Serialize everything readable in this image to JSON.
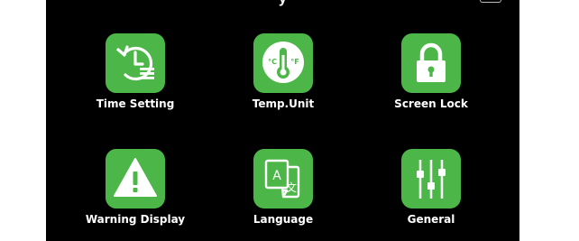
{
  "header": {
    "title_fragment": "y"
  },
  "colors": {
    "tile_green": "#4cb748",
    "background": "#000000",
    "text": "#ffffff"
  },
  "menu": {
    "items": [
      {
        "label": "Time Setting",
        "icon": "clock-history-icon"
      },
      {
        "label": "Temp.Unit",
        "icon": "thermometer-icon",
        "icon_text_c": "°C",
        "icon_text_f": "°F"
      },
      {
        "label": "Screen Lock",
        "icon": "lock-icon"
      },
      {
        "label": "Warning Display",
        "icon": "warning-icon"
      },
      {
        "label": "Language",
        "icon": "translate-icon",
        "icon_text_a": "A",
        "icon_text_b": "文"
      },
      {
        "label": "General",
        "icon": "sliders-icon"
      }
    ]
  }
}
